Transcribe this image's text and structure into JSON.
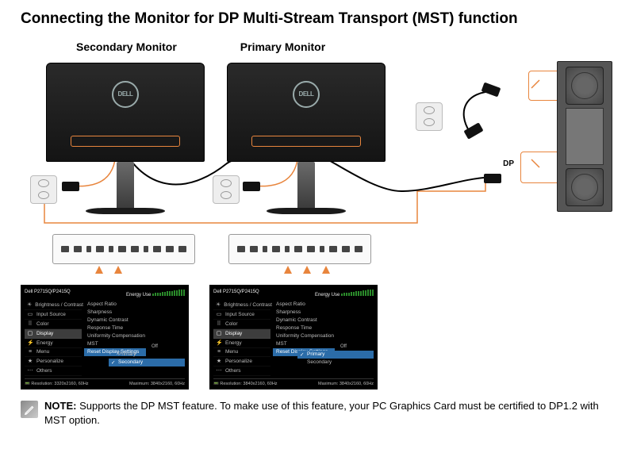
{
  "title": "Connecting the Monitor for DP Multi-Stream Transport (MST) function",
  "labels": {
    "secondary": "Secondary Monitor",
    "primary": "Primary Monitor",
    "dp": "DP"
  },
  "dell": "DELL",
  "osd": {
    "model": "Dell P2715Q/P2415Q",
    "energy_label": "Energy Use",
    "left_items": [
      {
        "icon": "☀",
        "label": "Brightness / Contrast"
      },
      {
        "icon": "▭",
        "label": "Input Source"
      },
      {
        "icon": "⠿",
        "label": "Color"
      },
      {
        "icon": "▢",
        "label": "Display",
        "sel": true
      },
      {
        "icon": "⚡",
        "label": "Energy"
      },
      {
        "icon": "≡",
        "label": "Menu"
      },
      {
        "icon": "★",
        "label": "Personalize"
      },
      {
        "icon": "⋯",
        "label": "Others"
      }
    ],
    "mid_items": [
      "Aspect Ratio",
      "Sharpness",
      "Dynamic Contrast",
      "Response Time",
      "Uniformity Compensation",
      "MST",
      "Reset Display Settings"
    ],
    "mst_value": "Off",
    "opt_primary": "Primary",
    "opt_secondary": "Secondary",
    "footer_res_label": "Resolution:",
    "footer_res_left": "3320x2160, 60Hz",
    "footer_res_right": "3840x2160, 60Hz",
    "footer_max_label": "Maximum:",
    "footer_max": "3840x2160, 60Hz",
    "secondary_selected": "secondary",
    "primary_selected": "primary"
  },
  "note": {
    "label": "NOTE:",
    "text": "Supports the DP MST feature. To make use of this feature, your PC Graphics Card must be certified to DP1.2 with MST option."
  }
}
